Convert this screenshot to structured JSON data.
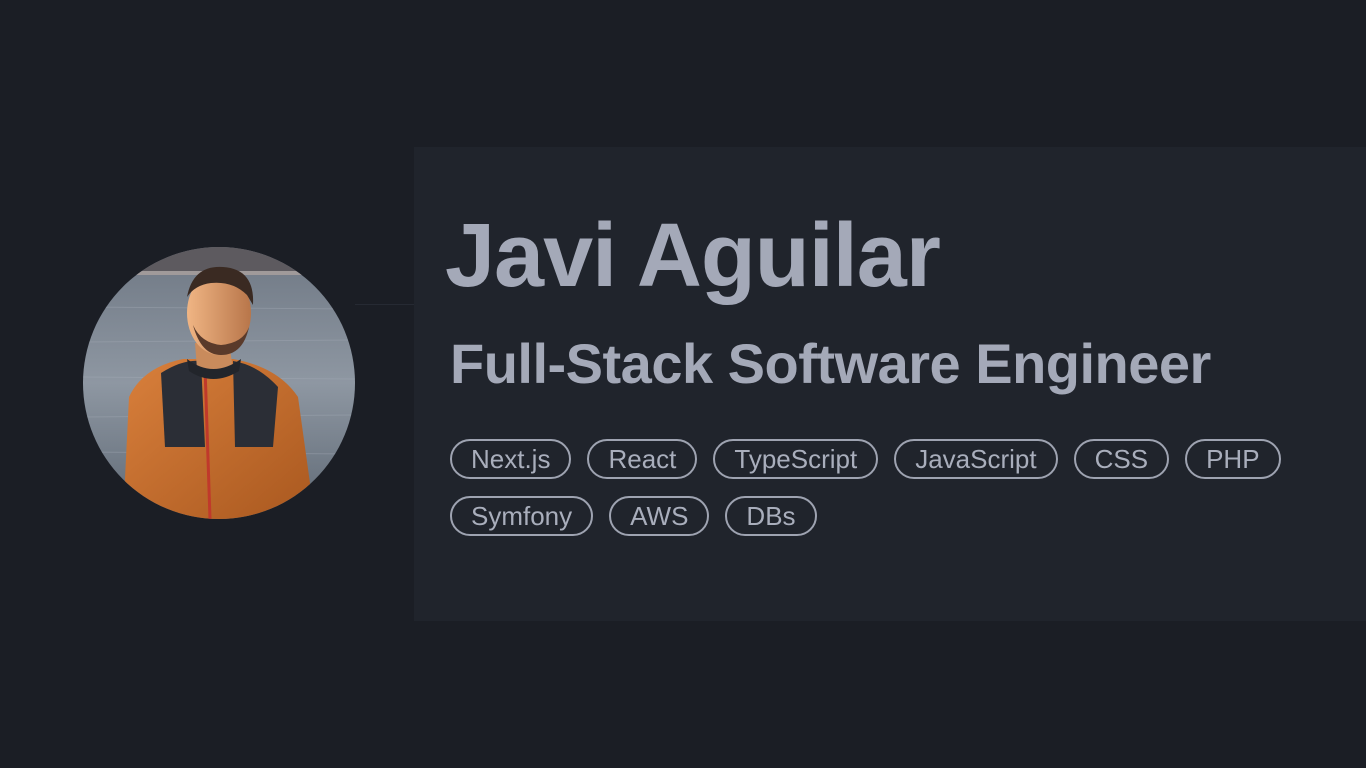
{
  "profile": {
    "name": "Javi Aguilar",
    "title": "Full-Stack Software Engineer",
    "skills": [
      "Next.js",
      "React",
      "TypeScript",
      "JavaScript",
      "CSS",
      "PHP",
      "Symfony",
      "AWS",
      "DBs"
    ]
  },
  "colors": {
    "page_background": "#1b1e25",
    "card_background": "#20242c",
    "text": "#a4a9b8",
    "tag_border": "#9ea3b1"
  }
}
